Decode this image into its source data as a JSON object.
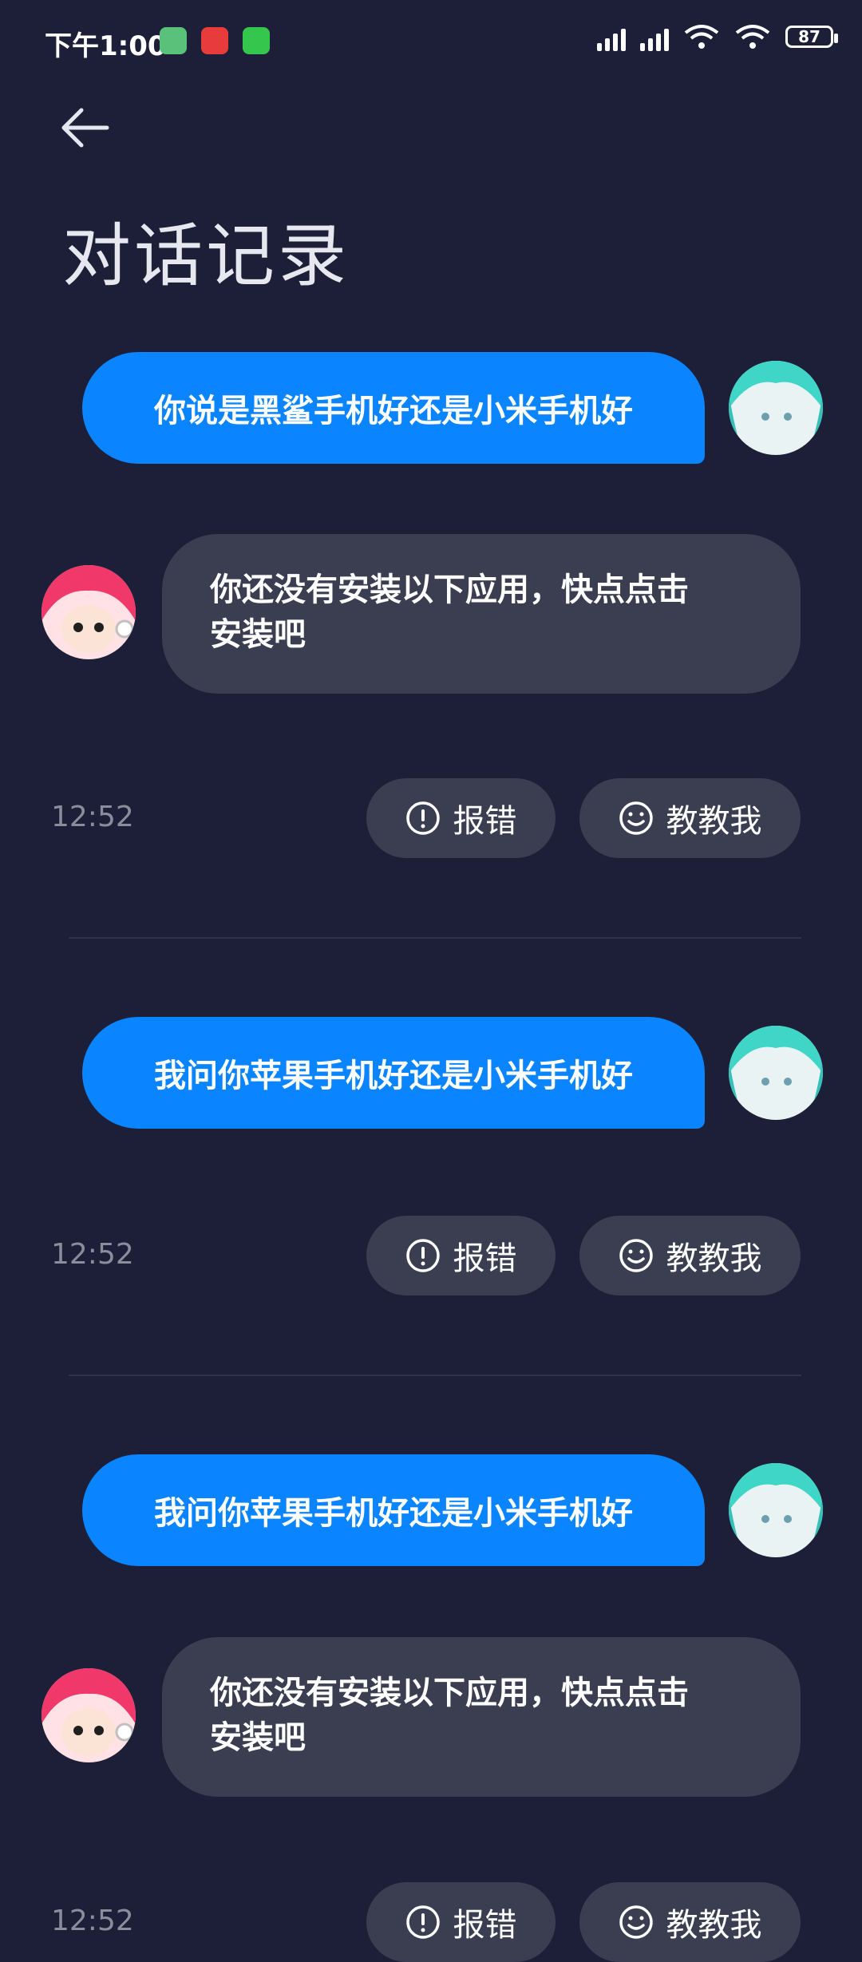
{
  "status_bar": {
    "time": "下午1:00",
    "battery": "87"
  },
  "header": {
    "title": "对话记录"
  },
  "conversation": [
    {
      "user_text": "你说是黑鲨手机好还是小米手机好",
      "bot_text_line1": "你还没有安装以下应用，快点点击",
      "bot_text_line2": "安装吧",
      "time": "12:52",
      "report_label": "报错",
      "teach_label": "教教我"
    },
    {
      "user_text": "我问你苹果手机好还是小米手机好",
      "time": "12:52",
      "report_label": "报错",
      "teach_label": "教教我"
    },
    {
      "user_text": "我问你苹果手机好还是小米手机好",
      "bot_text_line1": "你还没有安装以下应用，快点点击",
      "bot_text_line2": "安装吧",
      "time": "12:52",
      "report_label": "报错",
      "teach_label": "教教我"
    }
  ],
  "colors": {
    "background": "#1c1f37",
    "user_bubble": "#0a84ff",
    "bot_bubble": "#3b3e51"
  }
}
